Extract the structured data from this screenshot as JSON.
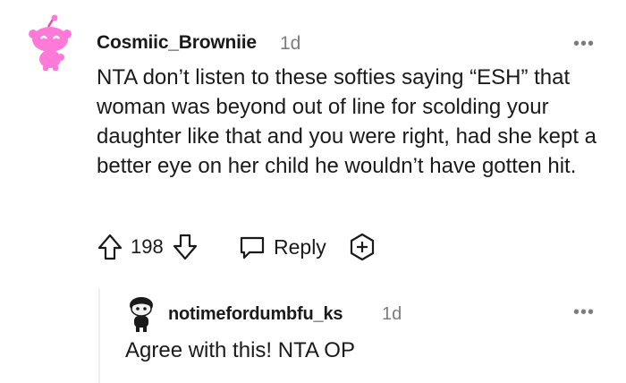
{
  "comment": {
    "avatar": "snoo-avatar-pink",
    "username": "Cosmiic_Browniie",
    "timestamp": "1d",
    "more_icon": "more-options-icon",
    "more_label": "•••",
    "body": "NTA don’t listen to these softies saying “ESH” that woman was beyond out of line for scolding your daughter like that and you were right, had she kept a better eye on her child he wouldn’t have gotten hit.",
    "actions": {
      "upvote_icon": "arrow-up-icon",
      "vote_count": "198",
      "downvote_icon": "arrow-down-icon",
      "reply_icon": "speech-bubble-icon",
      "reply_label": "Reply",
      "award_icon": "plus-award-icon"
    }
  },
  "reply": {
    "avatar": "snoo-avatar-dark",
    "username": "notimefordumbfu_ks",
    "timestamp": "1d",
    "more_label": "•••",
    "body": "Agree with this! NTA OP"
  },
  "colors": {
    "text": "#1a1a1b",
    "meta": "#7c7c7c",
    "avatar_pink": "#ff7ad8",
    "thread_line": "#edeff1"
  }
}
